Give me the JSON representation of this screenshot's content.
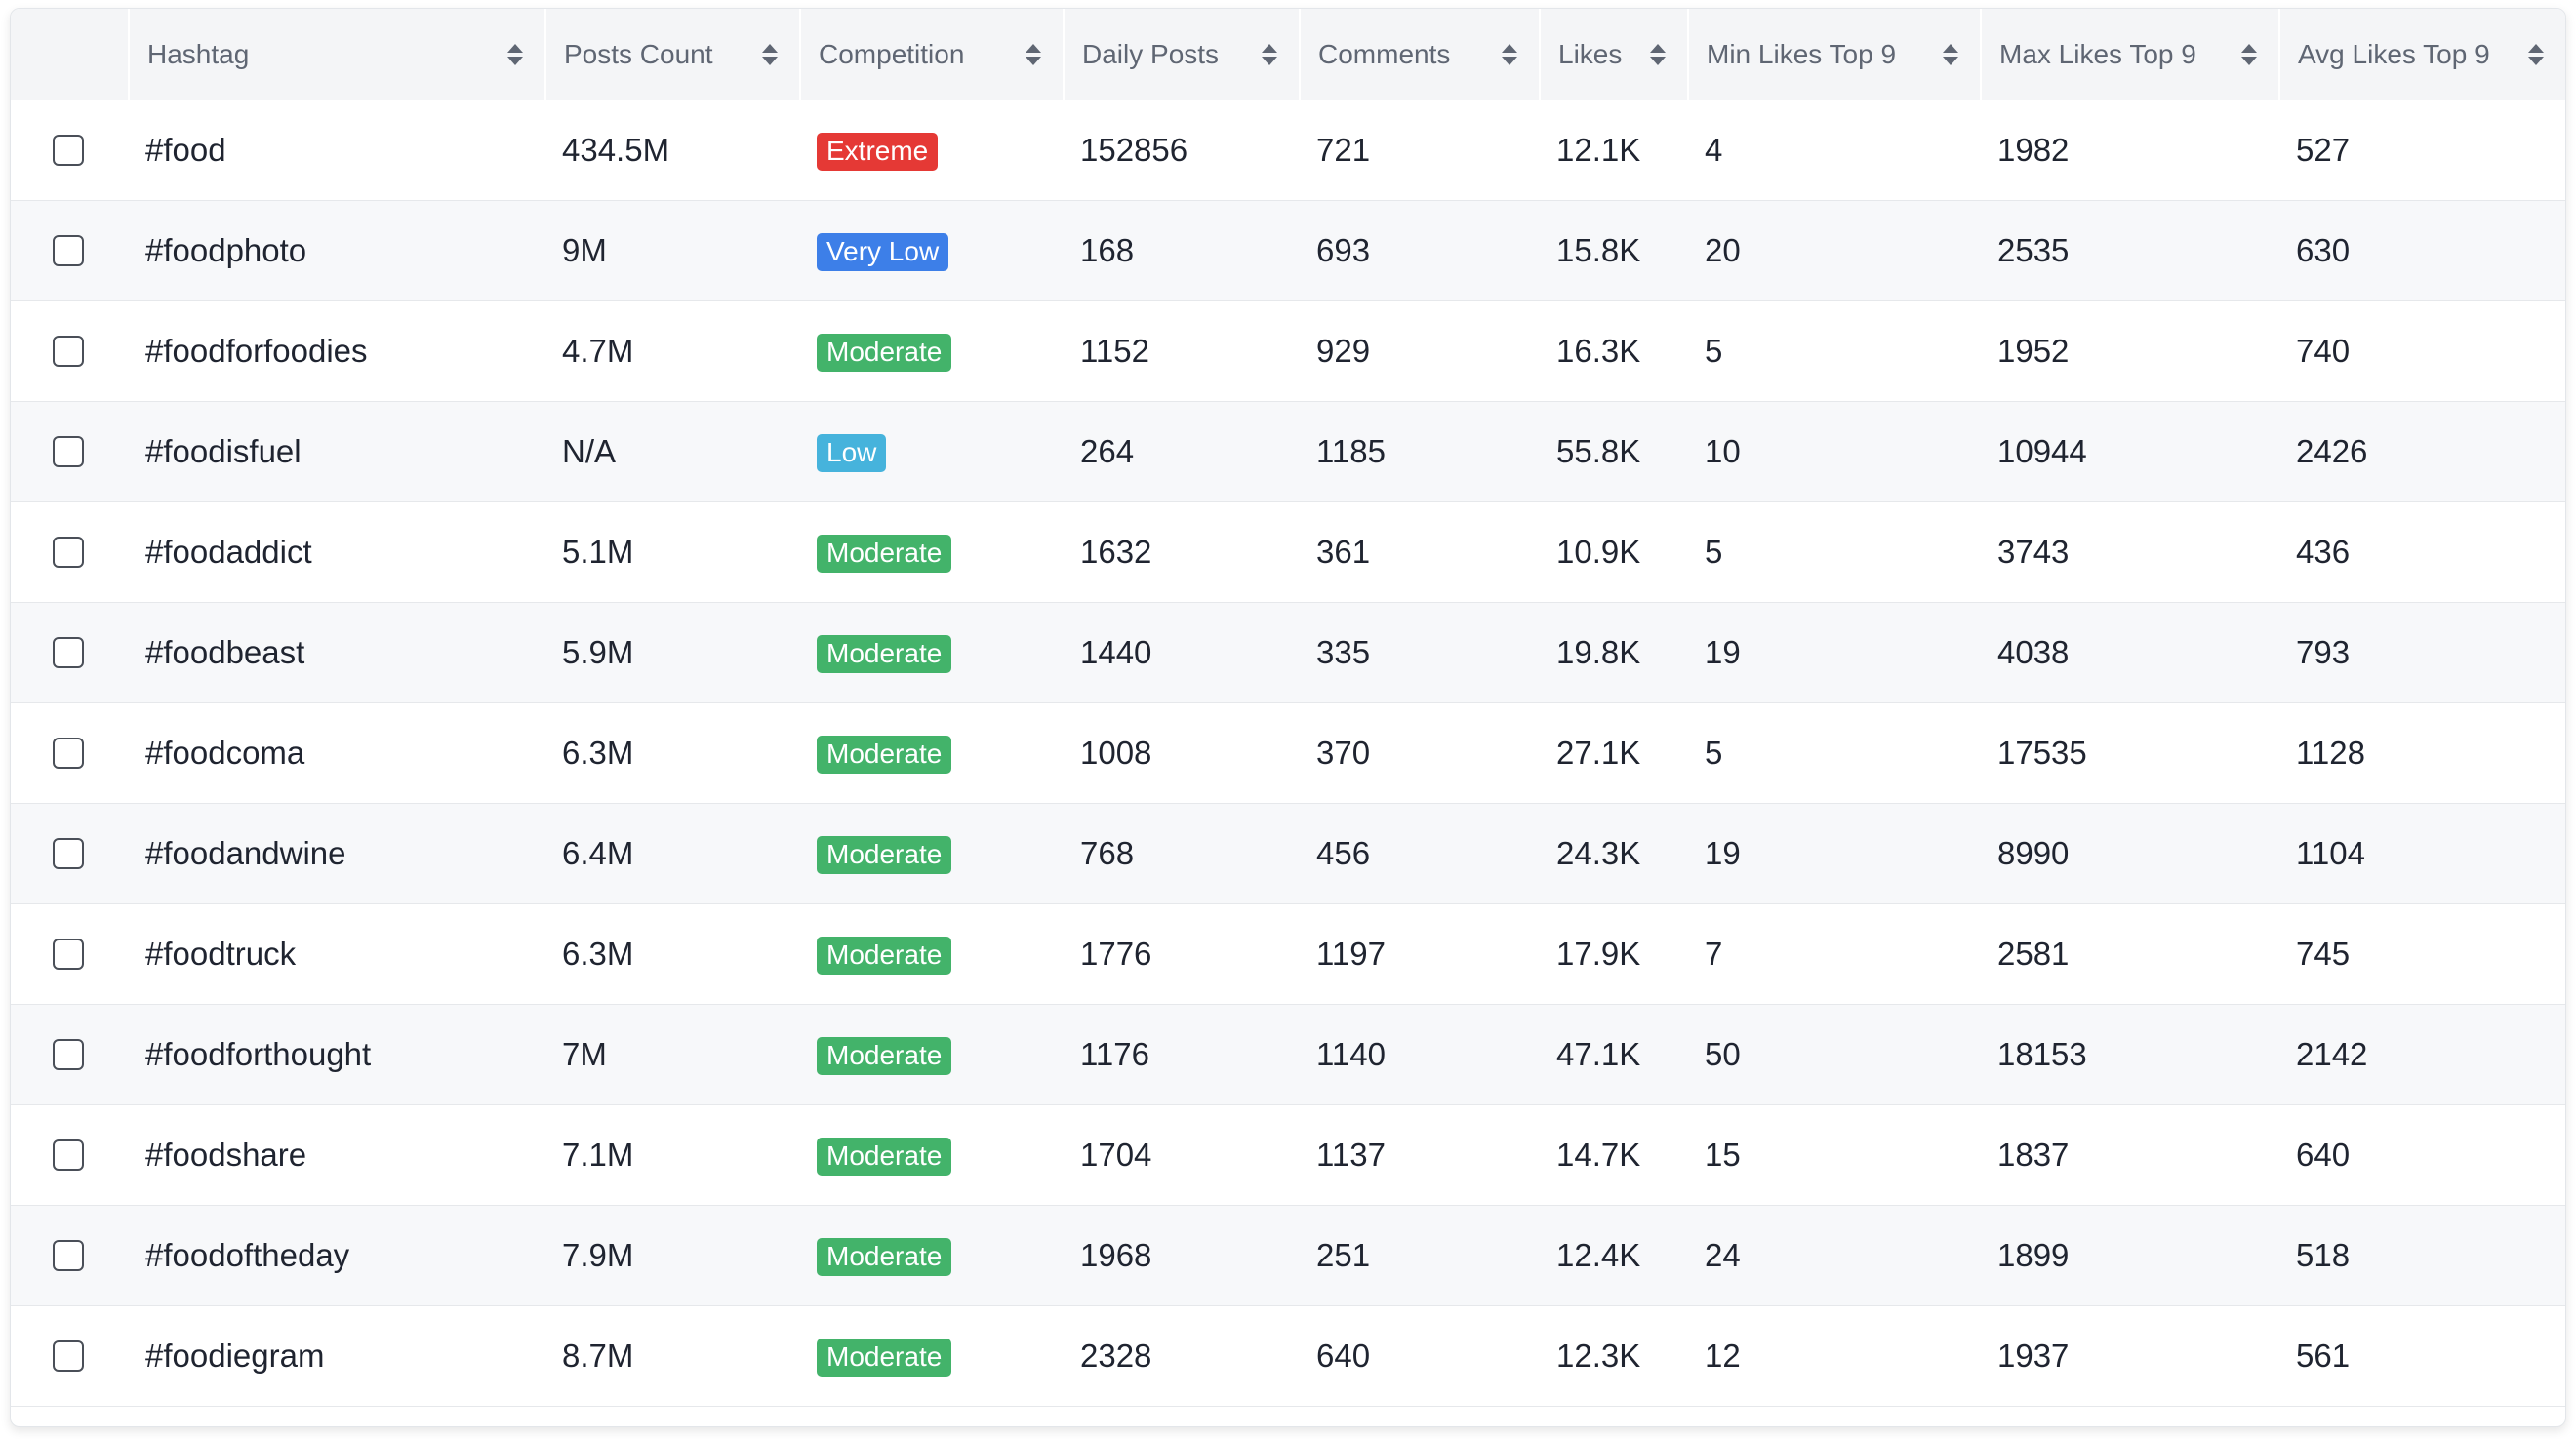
{
  "columns": [
    {
      "key": "hashtag",
      "label": "Hashtag"
    },
    {
      "key": "posts_count",
      "label": "Posts Count"
    },
    {
      "key": "competition",
      "label": "Competition"
    },
    {
      "key": "daily_posts",
      "label": "Daily Posts"
    },
    {
      "key": "comments",
      "label": "Comments"
    },
    {
      "key": "likes",
      "label": "Likes"
    },
    {
      "key": "min_likes_top9",
      "label": "Min Likes Top 9"
    },
    {
      "key": "max_likes_top9",
      "label": "Max Likes Top 9"
    },
    {
      "key": "avg_likes_top9",
      "label": "Avg Likes Top 9"
    }
  ],
  "badge_colors": {
    "Extreme": "#e53935",
    "Very Low": "#3d7fe8",
    "Moderate": "#43b36a",
    "Low": "#46b3dc"
  },
  "rows": [
    {
      "hashtag": "#food",
      "posts_count": "434.5M",
      "competition": "Extreme",
      "daily_posts": "152856",
      "comments": "721",
      "likes": "12.1K",
      "min_likes_top9": "4",
      "max_likes_top9": "1982",
      "avg_likes_top9": "527"
    },
    {
      "hashtag": "#foodphoto",
      "posts_count": "9M",
      "competition": "Very Low",
      "daily_posts": "168",
      "comments": "693",
      "likes": "15.8K",
      "min_likes_top9": "20",
      "max_likes_top9": "2535",
      "avg_likes_top9": "630"
    },
    {
      "hashtag": "#foodforfoodies",
      "posts_count": "4.7M",
      "competition": "Moderate",
      "daily_posts": "1152",
      "comments": "929",
      "likes": "16.3K",
      "min_likes_top9": "5",
      "max_likes_top9": "1952",
      "avg_likes_top9": "740"
    },
    {
      "hashtag": "#foodisfuel",
      "posts_count": "N/A",
      "competition": "Low",
      "daily_posts": "264",
      "comments": "1185",
      "likes": "55.8K",
      "min_likes_top9": "10",
      "max_likes_top9": "10944",
      "avg_likes_top9": "2426"
    },
    {
      "hashtag": "#foodaddict",
      "posts_count": "5.1M",
      "competition": "Moderate",
      "daily_posts": "1632",
      "comments": "361",
      "likes": "10.9K",
      "min_likes_top9": "5",
      "max_likes_top9": "3743",
      "avg_likes_top9": "436"
    },
    {
      "hashtag": "#foodbeast",
      "posts_count": "5.9M",
      "competition": "Moderate",
      "daily_posts": "1440",
      "comments": "335",
      "likes": "19.8K",
      "min_likes_top9": "19",
      "max_likes_top9": "4038",
      "avg_likes_top9": "793"
    },
    {
      "hashtag": "#foodcoma",
      "posts_count": "6.3M",
      "competition": "Moderate",
      "daily_posts": "1008",
      "comments": "370",
      "likes": "27.1K",
      "min_likes_top9": "5",
      "max_likes_top9": "17535",
      "avg_likes_top9": "1128"
    },
    {
      "hashtag": "#foodandwine",
      "posts_count": "6.4M",
      "competition": "Moderate",
      "daily_posts": "768",
      "comments": "456",
      "likes": "24.3K",
      "min_likes_top9": "19",
      "max_likes_top9": "8990",
      "avg_likes_top9": "1104"
    },
    {
      "hashtag": "#foodtruck",
      "posts_count": "6.3M",
      "competition": "Moderate",
      "daily_posts": "1776",
      "comments": "1197",
      "likes": "17.9K",
      "min_likes_top9": "7",
      "max_likes_top9": "2581",
      "avg_likes_top9": "745"
    },
    {
      "hashtag": "#foodforthought",
      "posts_count": "7M",
      "competition": "Moderate",
      "daily_posts": "1176",
      "comments": "1140",
      "likes": "47.1K",
      "min_likes_top9": "50",
      "max_likes_top9": "18153",
      "avg_likes_top9": "2142"
    },
    {
      "hashtag": "#foodshare",
      "posts_count": "7.1M",
      "competition": "Moderate",
      "daily_posts": "1704",
      "comments": "1137",
      "likes": "14.7K",
      "min_likes_top9": "15",
      "max_likes_top9": "1837",
      "avg_likes_top9": "640"
    },
    {
      "hashtag": "#foodoftheday",
      "posts_count": "7.9M",
      "competition": "Moderate",
      "daily_posts": "1968",
      "comments": "251",
      "likes": "12.4K",
      "min_likes_top9": "24",
      "max_likes_top9": "1899",
      "avg_likes_top9": "518"
    },
    {
      "hashtag": "#foodiegram",
      "posts_count": "8.7M",
      "competition": "Moderate",
      "daily_posts": "2328",
      "comments": "640",
      "likes": "12.3K",
      "min_likes_top9": "12",
      "max_likes_top9": "1937",
      "avg_likes_top9": "561"
    }
  ]
}
